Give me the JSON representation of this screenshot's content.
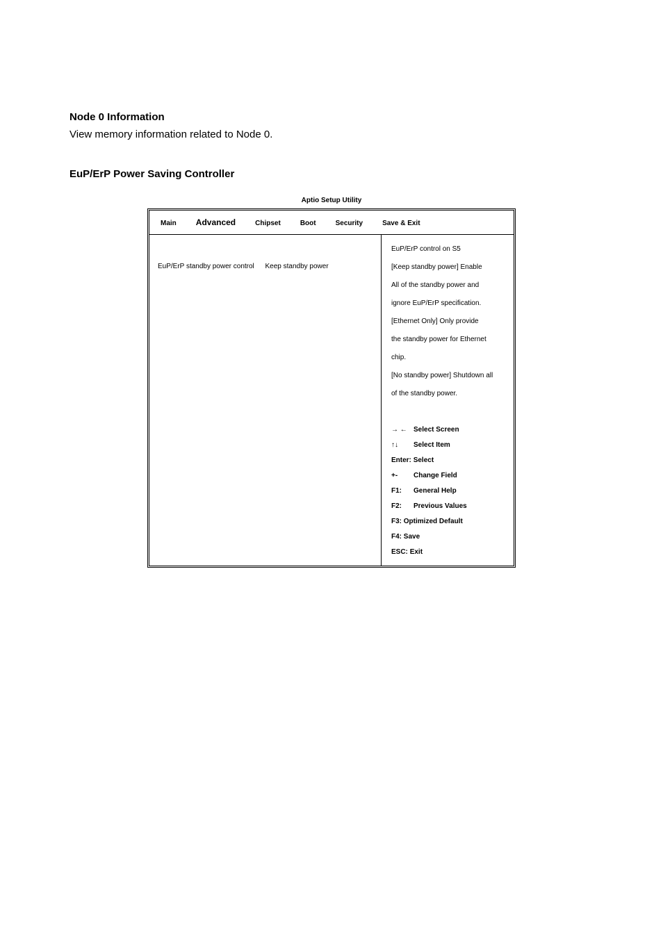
{
  "sections": {
    "node0": {
      "heading": "Node 0 Information",
      "body": "View memory information related to Node 0."
    },
    "eupErP": {
      "heading": "EuP/ErP Power Saving Controller"
    }
  },
  "bios": {
    "title": "Aptio Setup Utility",
    "tabs": [
      "Main",
      "Advanced",
      "Chipset",
      "Boot",
      "Security",
      "Save & Exit"
    ],
    "active_tab": "Advanced",
    "setting": {
      "label": "EuP/ErP standby power control",
      "value": "Keep standby power"
    },
    "help": [
      "EuP/ErP control on S5",
      "[Keep standby power] Enable",
      "All of the standby power and",
      "ignore EuP/ErP specification.",
      "[Ethernet Only] Only provide",
      "the standby power for Ethernet",
      "chip.",
      "[No standby power] Shutdown all",
      " of the standby power."
    ],
    "keys": {
      "selectScreen": {
        "key": "→ ←",
        "action": "Select Screen"
      },
      "selectItem": {
        "key": "↑↓",
        "action": "Select Item"
      },
      "enter": {
        "key": "Enter:",
        "action": "Select"
      },
      "change": {
        "key": "+-",
        "action": "Change Field"
      },
      "f1": {
        "key": "F1:",
        "action": "General Help"
      },
      "f2": {
        "key": "F2:",
        "action": "Previous Values"
      },
      "f3": {
        "key": "F3:",
        "action": "Optimized Default"
      },
      "f4": {
        "key": "F4:",
        "action": "Save"
      },
      "esc": {
        "key": "ESC:",
        "action": "Exit"
      }
    }
  }
}
